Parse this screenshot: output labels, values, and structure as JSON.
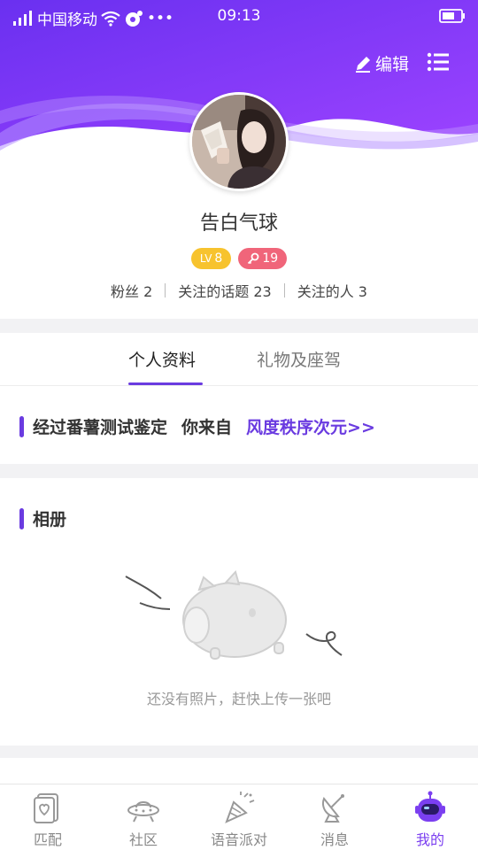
{
  "status_bar": {
    "carrier": "中国移动",
    "time": "09:13",
    "dots": "•••"
  },
  "header": {
    "edit_label": "编辑"
  },
  "profile": {
    "nickname": "告白气球",
    "level_badge": "8",
    "level_prefix": "LV",
    "charm_badge": "19",
    "fans_label": "粉丝 2",
    "topics_label": "关注的话题 23",
    "following_label": "关注的人 3"
  },
  "tabs": [
    {
      "label": "个人资料",
      "active": true
    },
    {
      "label": "礼物及座驾",
      "active": false
    }
  ],
  "test_result": {
    "text": "经过番薯测试鉴定",
    "from": "你来自",
    "link": "风度秩序次元>>"
  },
  "album": {
    "title": "相册",
    "empty_text": "还没有照片，赶快上传一张吧"
  },
  "bottom_nav": [
    {
      "label": "匹配",
      "icon": "card-icon",
      "active": false
    },
    {
      "label": "社区",
      "icon": "ufo-icon",
      "active": false
    },
    {
      "label": "语音派对",
      "icon": "party-horn-icon",
      "active": false
    },
    {
      "label": "消息",
      "icon": "satellite-dish-icon",
      "active": false
    },
    {
      "label": "我的",
      "icon": "astronaut-icon",
      "active": true
    }
  ],
  "colors": {
    "primary": "#6a3be0",
    "gradient_start": "#6a30f0",
    "gradient_end": "#9b42ff",
    "level": "#f7c32e",
    "charm": "#f0657a"
  }
}
